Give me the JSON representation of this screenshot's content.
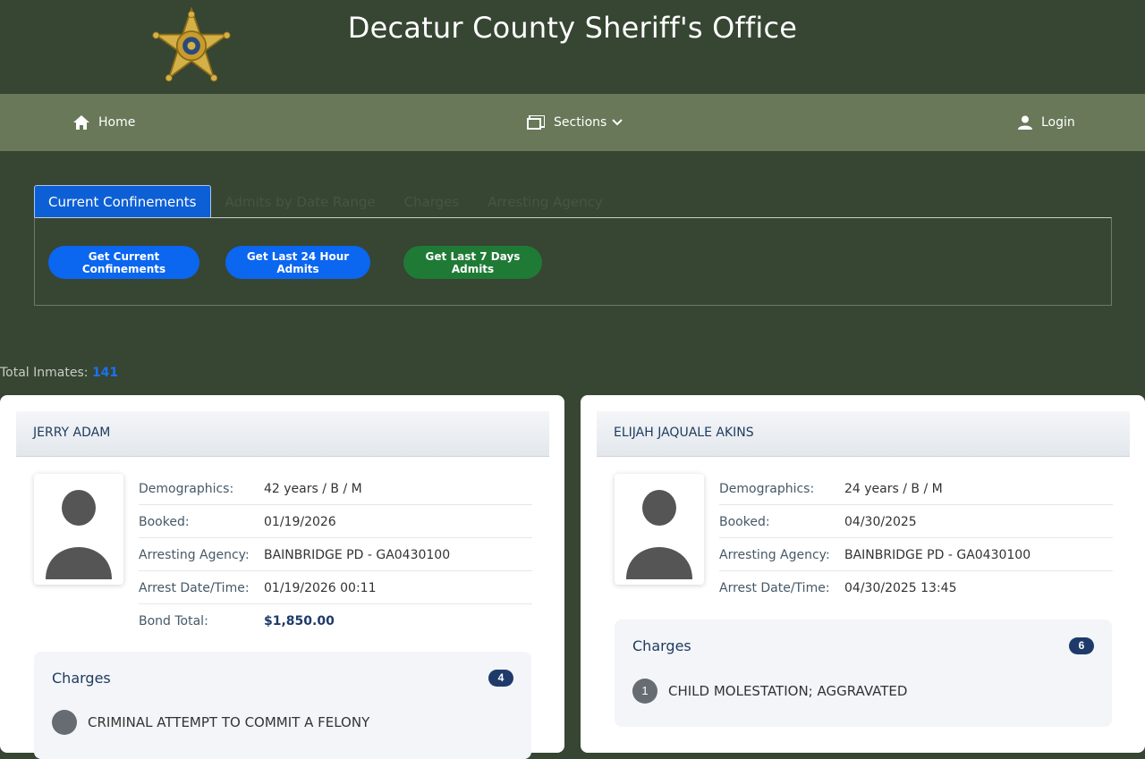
{
  "header": {
    "title": "Decatur County Sheriff's Office",
    "logo_icon": "sheriff-star-badge"
  },
  "nav": {
    "home": "Home",
    "sections": "Sections",
    "login": "Login"
  },
  "tabs": [
    {
      "label": "Current Confinements",
      "active": true
    },
    {
      "label": "Admits by Date Range",
      "active": false
    },
    {
      "label": "Charges",
      "active": false
    },
    {
      "label": "Arresting Agency",
      "active": false
    }
  ],
  "actions": {
    "current": "Get Current Confinements",
    "last24": "Get Last 24 Hour Admits",
    "last7": "Get Last 7 Days Admits"
  },
  "total": {
    "label": "Total Inmates:",
    "count": "141"
  },
  "labels": {
    "demographics": "Demographics:",
    "booked": "Booked:",
    "agency": "Arresting Agency:",
    "arrest": "Arrest Date/Time:",
    "bond": "Bond Total:",
    "charges": "Charges"
  },
  "inmates": [
    {
      "name": "JERRY ADAM",
      "demographics": "42 years / B / M",
      "booked": "01/19/2026",
      "agency": "BAINBRIDGE PD - GA0430100",
      "arrest": "01/19/2026 00:11",
      "bond": "$1,850.00",
      "charge_count": "4",
      "first_charge": "CRIMINAL ATTEMPT TO COMMIT A FELONY"
    },
    {
      "name": "ELIJAH JAQUALE AKINS",
      "demographics": "24 years / B / M",
      "booked": "04/30/2025",
      "agency": "BAINBRIDGE PD - GA0430100",
      "arrest": "04/30/2025 13:45",
      "charge_count": "6",
      "first_charge_num": "1",
      "first_charge": "CHILD MOLESTATION; AGGRAVATED"
    }
  ],
  "colors": {
    "header_bg": "#374533",
    "nav_bg": "#687858",
    "accent_blue": "#0b66f0",
    "accent_green": "#1f7a35"
  }
}
